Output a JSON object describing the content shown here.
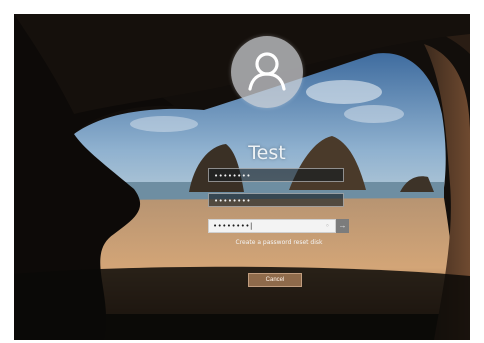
{
  "user": {
    "name": "Test",
    "avatar_icon": "user-avatar-icon"
  },
  "fields": {
    "old_password_mask": "••••••••",
    "new_password_mask": "••••••••",
    "confirm_password_mask": "••••••••|",
    "reveal_icon": "eye-icon",
    "submit_icon": "arrow-right-icon",
    "submit_glyph": "→"
  },
  "links": {
    "reset_disk": "Create a password reset disk"
  },
  "buttons": {
    "cancel_label": "Cancel"
  },
  "colors": {
    "sky": "#5f86b3",
    "sand": "#c9996c",
    "cave": "#120e0b"
  }
}
